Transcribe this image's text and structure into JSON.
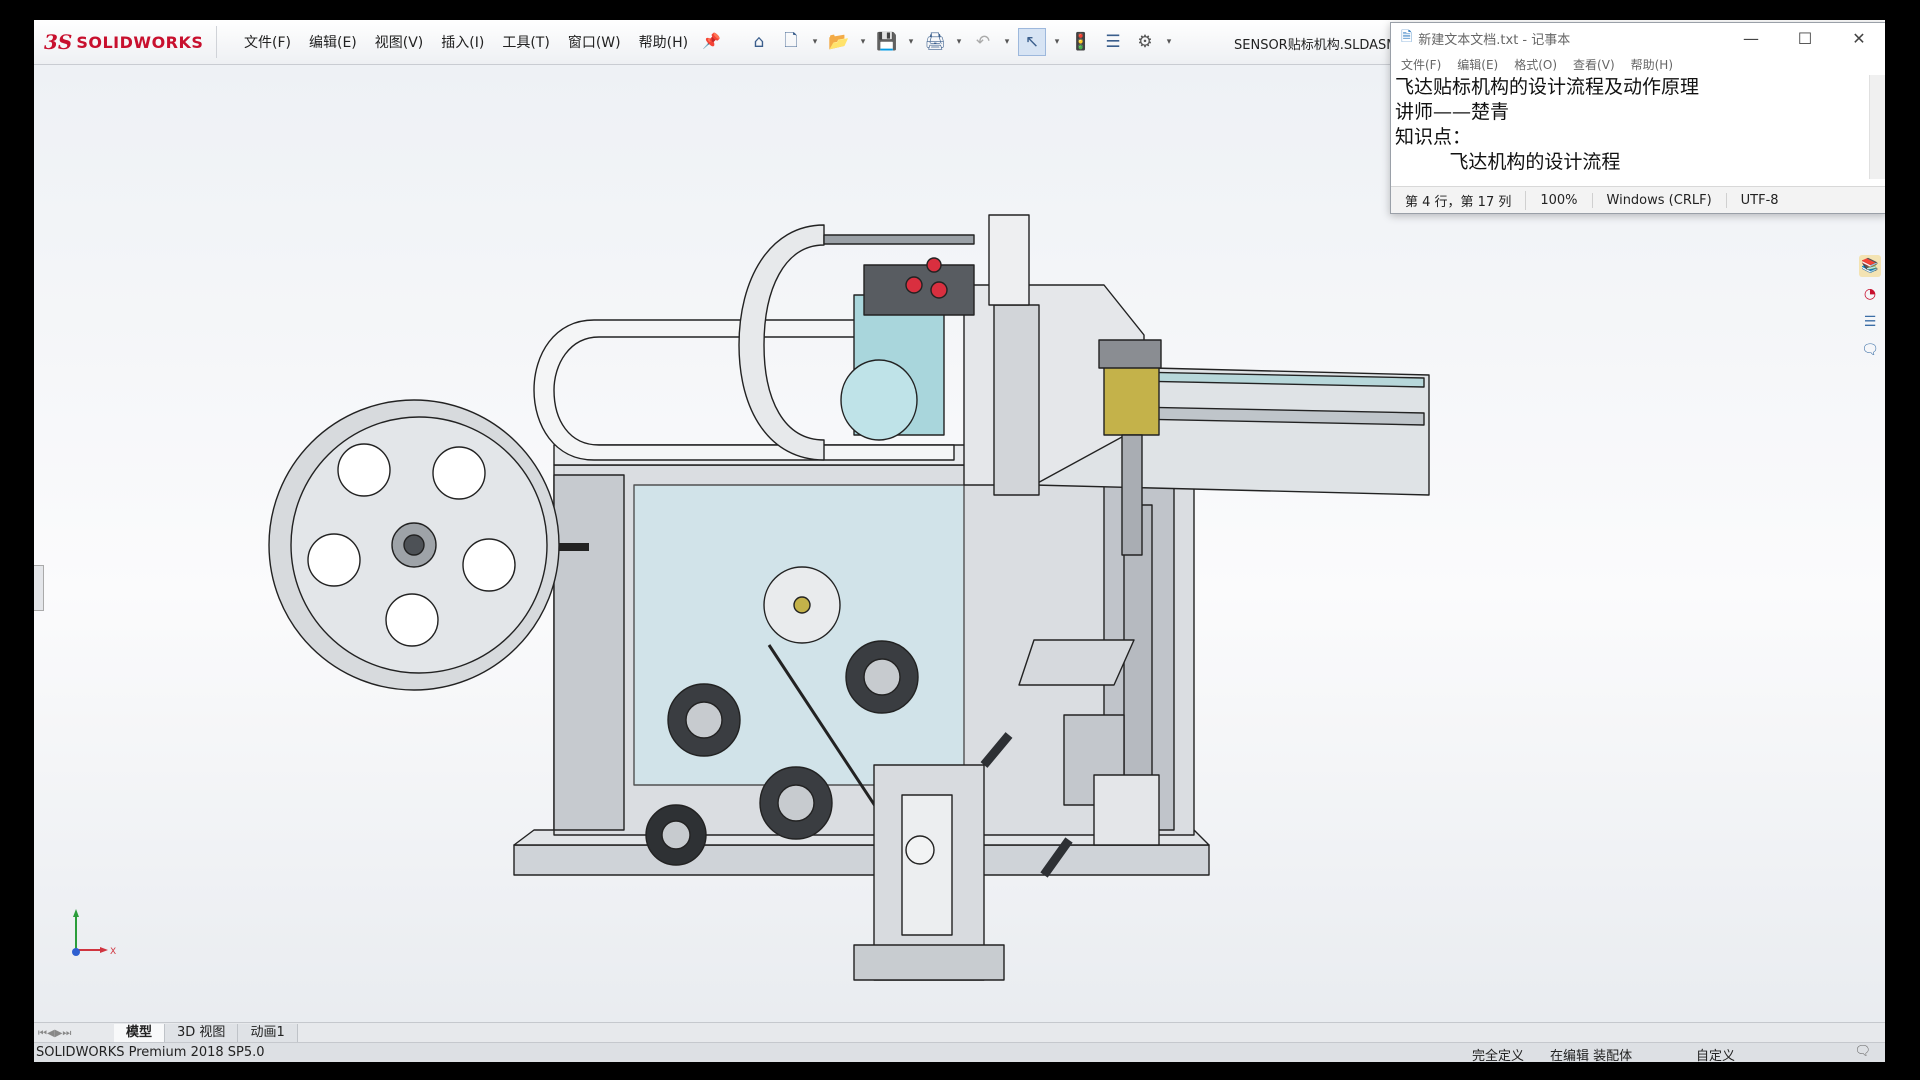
{
  "app": {
    "logo_ds": "3S",
    "logo_text": "SOLIDWORKS",
    "document_title": "SENSOR贴标机构.SLDASM"
  },
  "menu": [
    "文件(F)",
    "编辑(E)",
    "视图(V)",
    "插入(I)",
    "工具(T)",
    "窗口(W)",
    "帮助(H)"
  ],
  "toolbar_icons": [
    "home-icon",
    "new-document-icon",
    "open-icon",
    "save-icon",
    "print-icon",
    "undo-icon",
    "select-icon",
    "traffic-light-icon",
    "file-properties-icon",
    "options-gear-icon"
  ],
  "view_toolbar_icons": [
    "zoom-to-fit-icon",
    "zoom-area-icon",
    "previous-view-icon",
    "section-view-icon",
    "dynamic-annotation-icon",
    "view-orientation-icon",
    "display-style-icon",
    "hide-show-icon",
    "edit-appearance-icon",
    "apply-scene-icon",
    "view-settings-icon"
  ],
  "notepad": {
    "title": "新建文本文档.txt - 记事本",
    "menu": [
      "文件(F)",
      "编辑(E)",
      "格式(O)",
      "查看(V)",
      "帮助(H)"
    ],
    "lines": [
      "飞达贴标机构的设计流程及动作原理",
      "讲师——楚青",
      "知识点：",
      "         飞达机构的设计流程"
    ],
    "status": {
      "position": "第 4 行，第 17 列",
      "zoom": "100%",
      "line_ending": "Windows (CRLF)",
      "encoding": "UTF-8"
    }
  },
  "tabs": {
    "items": [
      "模型",
      "3D 视图",
      "动画1"
    ],
    "active": "模型"
  },
  "status_bar": {
    "version": "SOLIDWORKS Premium 2018 SP5.0",
    "definition": "完全定义",
    "editing": "在编辑 装配体",
    "units": "自定义"
  },
  "triad": {
    "x_label": "X"
  },
  "colors": {
    "brand": "#c8102e",
    "viewport_top": "#eef1f5",
    "part_gray": "#c9cdd2",
    "part_yellow": "#c4b24a",
    "part_teal": "#a9d6dc"
  }
}
